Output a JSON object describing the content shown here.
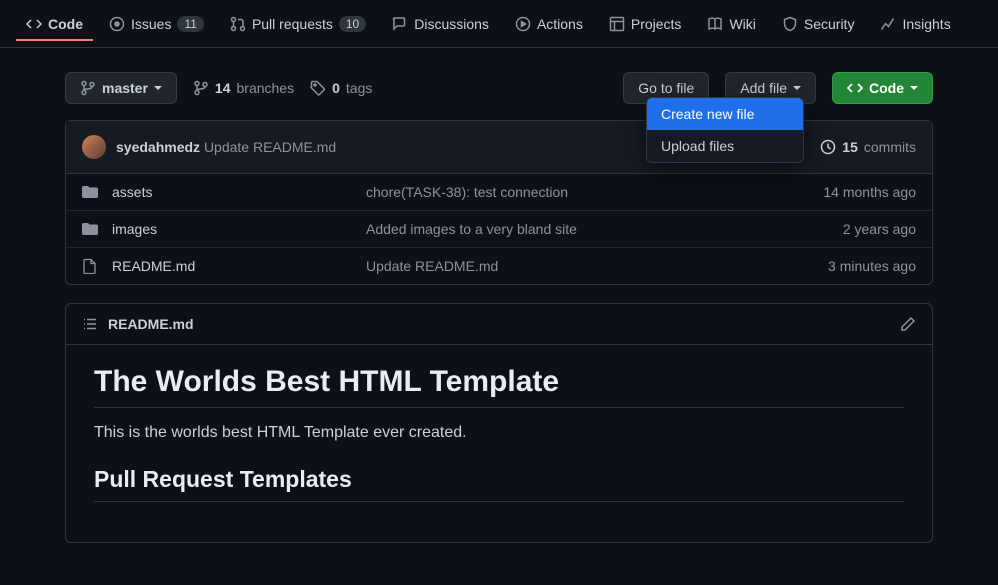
{
  "nav": {
    "code": "Code",
    "issues": "Issues",
    "issues_count": "11",
    "pulls": "Pull requests",
    "pulls_count": "10",
    "discussions": "Discussions",
    "actions": "Actions",
    "projects": "Projects",
    "wiki": "Wiki",
    "security": "Security",
    "insights": "Insights"
  },
  "toolbar": {
    "branch": "master",
    "branches_count": "14",
    "branches_label": "branches",
    "tags_count": "0",
    "tags_label": "tags",
    "go_to_file": "Go to file",
    "add_file": "Add file",
    "code": "Code"
  },
  "dropdown": {
    "create": "Create new file",
    "upload": "Upload files"
  },
  "header": {
    "author": "syedahmedz",
    "message": "Update README.md",
    "commits_count": "15",
    "commits_label": "commits"
  },
  "files": [
    {
      "type": "dir",
      "name": "assets",
      "msg": "chore(TASK-38): test connection",
      "time": "14 months ago"
    },
    {
      "type": "dir",
      "name": "images",
      "msg": "Added images to a very bland site",
      "time": "2 years ago"
    },
    {
      "type": "file",
      "name": "README.md",
      "msg": "Update README.md",
      "time": "3 minutes ago"
    }
  ],
  "readme": {
    "filename": "README.md",
    "h1": "The Worlds Best HTML Template",
    "p": "This is the worlds best HTML Template ever created.",
    "h2": "Pull Request Templates"
  }
}
